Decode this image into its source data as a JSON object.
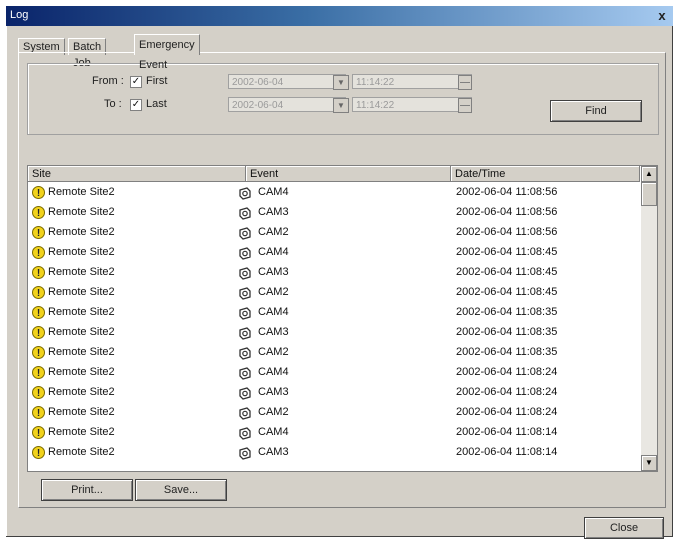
{
  "window": {
    "title": "Log",
    "close_glyph": "x"
  },
  "tabs": [
    {
      "label": "System",
      "active": false
    },
    {
      "label": "Batch Job",
      "active": false
    },
    {
      "label": "Emergency Event",
      "active": true
    }
  ],
  "filter": {
    "from_label": "From :",
    "from_checkbox_label": "First",
    "from_checked": true,
    "from_date": "2002-06-04",
    "from_time": "11:14:22",
    "to_label": "To :",
    "to_checkbox_label": "Last",
    "to_checked": true,
    "to_date": "2002-06-04",
    "to_time": "11:14:22",
    "find_label": "Find"
  },
  "list": {
    "columns": [
      "Site",
      "Event",
      "Date/Time"
    ],
    "rows": [
      {
        "site": "Remote Site2",
        "event": "CAM4",
        "datetime": "2002-06-04 11:08:56"
      },
      {
        "site": "Remote Site2",
        "event": "CAM3",
        "datetime": "2002-06-04 11:08:56"
      },
      {
        "site": "Remote Site2",
        "event": "CAM2",
        "datetime": "2002-06-04 11:08:56"
      },
      {
        "site": "Remote Site2",
        "event": "CAM4",
        "datetime": "2002-06-04 11:08:45"
      },
      {
        "site": "Remote Site2",
        "event": "CAM3",
        "datetime": "2002-06-04 11:08:45"
      },
      {
        "site": "Remote Site2",
        "event": "CAM2",
        "datetime": "2002-06-04 11:08:45"
      },
      {
        "site": "Remote Site2",
        "event": "CAM4",
        "datetime": "2002-06-04 11:08:35"
      },
      {
        "site": "Remote Site2",
        "event": "CAM3",
        "datetime": "2002-06-04 11:08:35"
      },
      {
        "site": "Remote Site2",
        "event": "CAM2",
        "datetime": "2002-06-04 11:08:35"
      },
      {
        "site": "Remote Site2",
        "event": "CAM4",
        "datetime": "2002-06-04 11:08:24"
      },
      {
        "site": "Remote Site2",
        "event": "CAM3",
        "datetime": "2002-06-04 11:08:24"
      },
      {
        "site": "Remote Site2",
        "event": "CAM2",
        "datetime": "2002-06-04 11:08:24"
      },
      {
        "site": "Remote Site2",
        "event": "CAM4",
        "datetime": "2002-06-04 11:08:14"
      },
      {
        "site": "Remote Site2",
        "event": "CAM3",
        "datetime": "2002-06-04 11:08:14"
      }
    ]
  },
  "icons": {
    "row_site": "warning-icon",
    "row_event": "camera-icon"
  },
  "buttons": {
    "print": "Print...",
    "save": "Save...",
    "close": "Close"
  },
  "colors": {
    "title_bar": "#0a246a",
    "window_bg": "#d4d0c8",
    "warning": "#f1d21b"
  }
}
